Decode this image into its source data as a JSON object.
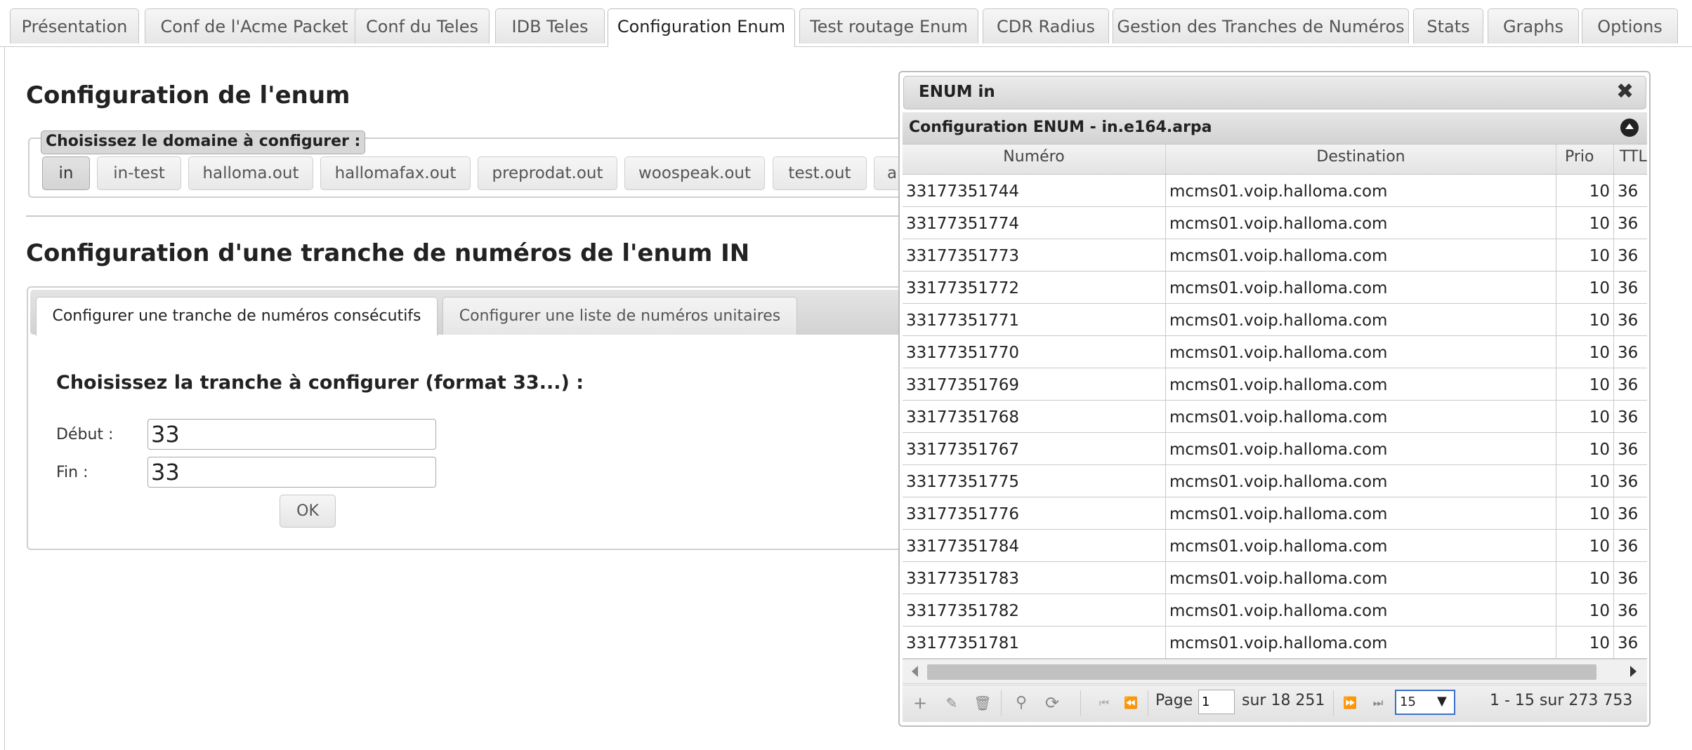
{
  "top_tabs": [
    {
      "label": "Présentation"
    },
    {
      "label": "Conf de l'Acme Packet"
    },
    {
      "label": "Conf du Teles"
    },
    {
      "label": "IDB Teles"
    },
    {
      "label": "Configuration Enum"
    },
    {
      "label": "Test routage Enum"
    },
    {
      "label": "CDR Radius"
    },
    {
      "label": "Gestion des Tranches de Numéros"
    },
    {
      "label": "Stats"
    },
    {
      "label": "Graphs"
    },
    {
      "label": "Options"
    }
  ],
  "active_top_tab": "Configuration Enum",
  "main": {
    "title": "Configuration de l'enum",
    "domain_legend": "Choisissez le domaine à configurer :",
    "domains": [
      "in",
      "in-test",
      "halloma.out",
      "hallomafax.out",
      "preprodat.out",
      "woospeak.out",
      "test.out",
      "a"
    ],
    "active_domain": "in",
    "range_title": "Configuration d'une tranche de numéros de l'enum IN",
    "subtabs": [
      {
        "label": "Configurer une tranche de numéros consécutifs"
      },
      {
        "label": "Configurer une liste de numéros unitaires"
      }
    ],
    "form": {
      "heading": "Choisissez la tranche à configurer (format 33...) :",
      "start_label": "Début :",
      "start_value": "33",
      "end_label": "Fin :",
      "end_value": "33",
      "ok_label": "OK"
    }
  },
  "dialog": {
    "title": "ENUM in",
    "grid_caption": "Configuration ENUM - in.e164.arpa",
    "columns": [
      "Numéro",
      "Destination",
      "Prio",
      "TTL"
    ],
    "rows": [
      {
        "numero": "33177351744",
        "destination": "mcms01.voip.halloma.com",
        "prio": "10",
        "ttl": "36"
      },
      {
        "numero": "33177351774",
        "destination": "mcms01.voip.halloma.com",
        "prio": "10",
        "ttl": "36"
      },
      {
        "numero": "33177351773",
        "destination": "mcms01.voip.halloma.com",
        "prio": "10",
        "ttl": "36"
      },
      {
        "numero": "33177351772",
        "destination": "mcms01.voip.halloma.com",
        "prio": "10",
        "ttl": "36"
      },
      {
        "numero": "33177351771",
        "destination": "mcms01.voip.halloma.com",
        "prio": "10",
        "ttl": "36"
      },
      {
        "numero": "33177351770",
        "destination": "mcms01.voip.halloma.com",
        "prio": "10",
        "ttl": "36"
      },
      {
        "numero": "33177351769",
        "destination": "mcms01.voip.halloma.com",
        "prio": "10",
        "ttl": "36"
      },
      {
        "numero": "33177351768",
        "destination": "mcms01.voip.halloma.com",
        "prio": "10",
        "ttl": "36"
      },
      {
        "numero": "33177351767",
        "destination": "mcms01.voip.halloma.com",
        "prio": "10",
        "ttl": "36"
      },
      {
        "numero": "33177351775",
        "destination": "mcms01.voip.halloma.com",
        "prio": "10",
        "ttl": "36"
      },
      {
        "numero": "33177351776",
        "destination": "mcms01.voip.halloma.com",
        "prio": "10",
        "ttl": "36"
      },
      {
        "numero": "33177351784",
        "destination": "mcms01.voip.halloma.com",
        "prio": "10",
        "ttl": "36"
      },
      {
        "numero": "33177351783",
        "destination": "mcms01.voip.halloma.com",
        "prio": "10",
        "ttl": "36"
      },
      {
        "numero": "33177351782",
        "destination": "mcms01.voip.halloma.com",
        "prio": "10",
        "ttl": "36"
      },
      {
        "numero": "33177351781",
        "destination": "mcms01.voip.halloma.com",
        "prio": "10",
        "ttl": "36"
      }
    ],
    "pager": {
      "page_label": "Page",
      "page_value": "1",
      "of_label": "sur 18 251",
      "rows_per_page": "15",
      "record_info": "1 - 15 sur 273 753"
    },
    "icons": {
      "add": "plus-icon",
      "edit": "pencil-icon",
      "delete": "trash-icon",
      "search": "search-icon",
      "refresh": "refresh-icon",
      "first": "first-page-icon",
      "prev": "prev-page-icon",
      "next": "next-page-icon",
      "last": "last-page-icon",
      "close": "close-icon",
      "collapse": "collapse-icon"
    }
  }
}
